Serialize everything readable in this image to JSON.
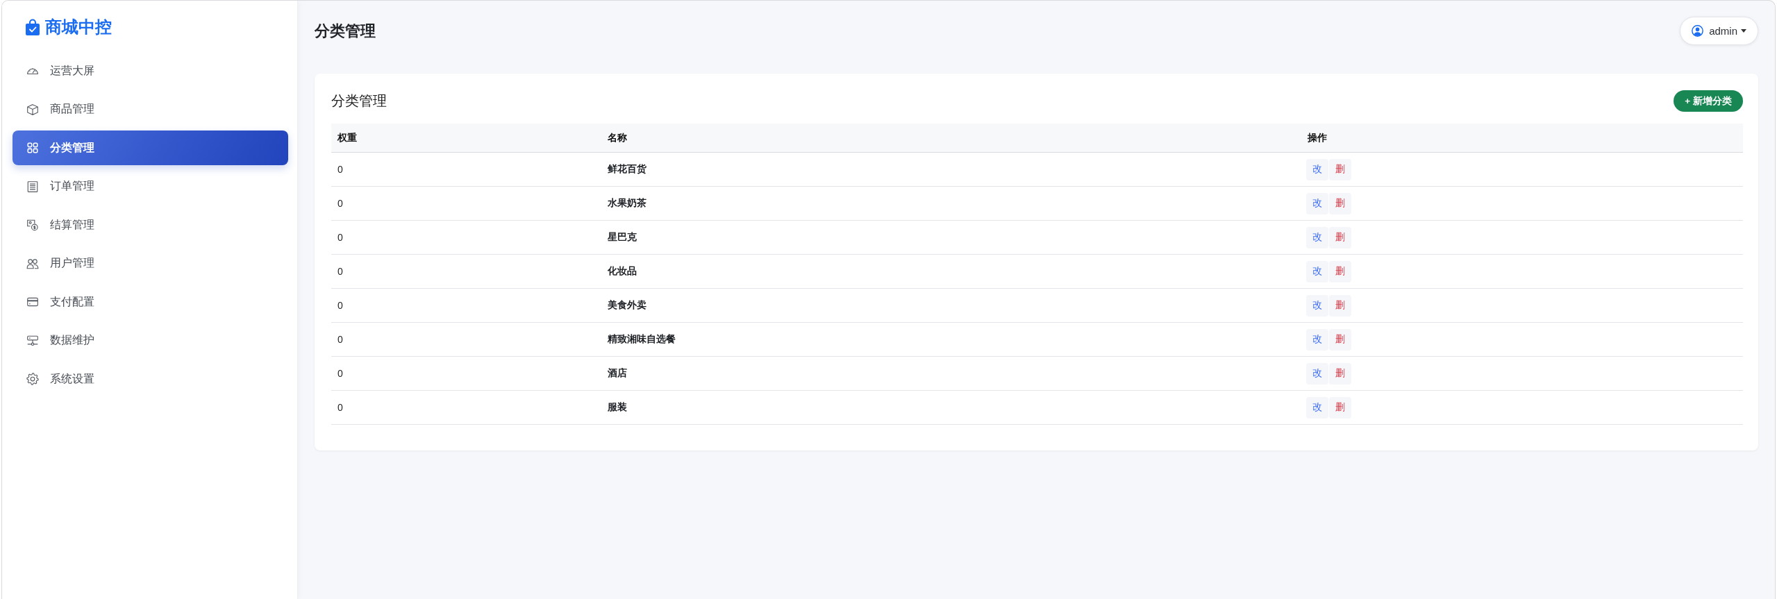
{
  "brand": {
    "title": "商城中控"
  },
  "sidebar": {
    "items": [
      {
        "label": "运营大屏",
        "selected": false
      },
      {
        "label": "商品管理",
        "selected": false
      },
      {
        "label": "分类管理",
        "selected": true
      },
      {
        "label": "订单管理",
        "selected": false
      },
      {
        "label": "结算管理",
        "selected": false
      },
      {
        "label": "用户管理",
        "selected": false
      },
      {
        "label": "支付配置",
        "selected": false
      },
      {
        "label": "数据维护",
        "selected": false
      },
      {
        "label": "系统设置",
        "selected": false
      }
    ]
  },
  "header": {
    "title": "分类管理",
    "user": {
      "name": "admin"
    }
  },
  "card": {
    "title": "分类管理",
    "add_button": "+ 新增分类",
    "table": {
      "columns": [
        "权重",
        "名称",
        "操作"
      ],
      "rows": [
        {
          "weight": "0",
          "name": "鲜花百货",
          "actions": [
            {
              "kind": "edit",
              "label": "改"
            },
            {
              "kind": "delete",
              "label": "删"
            }
          ]
        },
        {
          "weight": "0",
          "name": "水果奶茶",
          "actions": [
            {
              "kind": "edit",
              "label": "改"
            },
            {
              "kind": "delete",
              "label": "删"
            }
          ]
        },
        {
          "weight": "0",
          "name": "星巴克",
          "actions": [
            {
              "kind": "edit",
              "label": "改"
            },
            {
              "kind": "delete",
              "label": "删"
            }
          ]
        },
        {
          "weight": "0",
          "name": "化妆品",
          "actions": [
            {
              "kind": "edit",
              "label": "改"
            },
            {
              "kind": "delete",
              "label": "删"
            }
          ]
        },
        {
          "weight": "0",
          "name": "美食外卖",
          "actions": [
            {
              "kind": "edit",
              "label": "改"
            },
            {
              "kind": "delete",
              "label": "删"
            }
          ]
        },
        {
          "weight": "0",
          "name": "精致湘味自选餐",
          "actions": [
            {
              "kind": "edit",
              "label": "改"
            },
            {
              "kind": "delete",
              "label": "删"
            }
          ]
        },
        {
          "weight": "0",
          "name": "酒店",
          "actions": [
            {
              "kind": "edit",
              "label": "改"
            },
            {
              "kind": "delete",
              "label": "删"
            }
          ]
        },
        {
          "weight": "0",
          "name": "服装",
          "actions": [
            {
              "kind": "edit",
              "label": "改"
            },
            {
              "kind": "delete",
              "label": "删"
            }
          ]
        }
      ]
    }
  }
}
